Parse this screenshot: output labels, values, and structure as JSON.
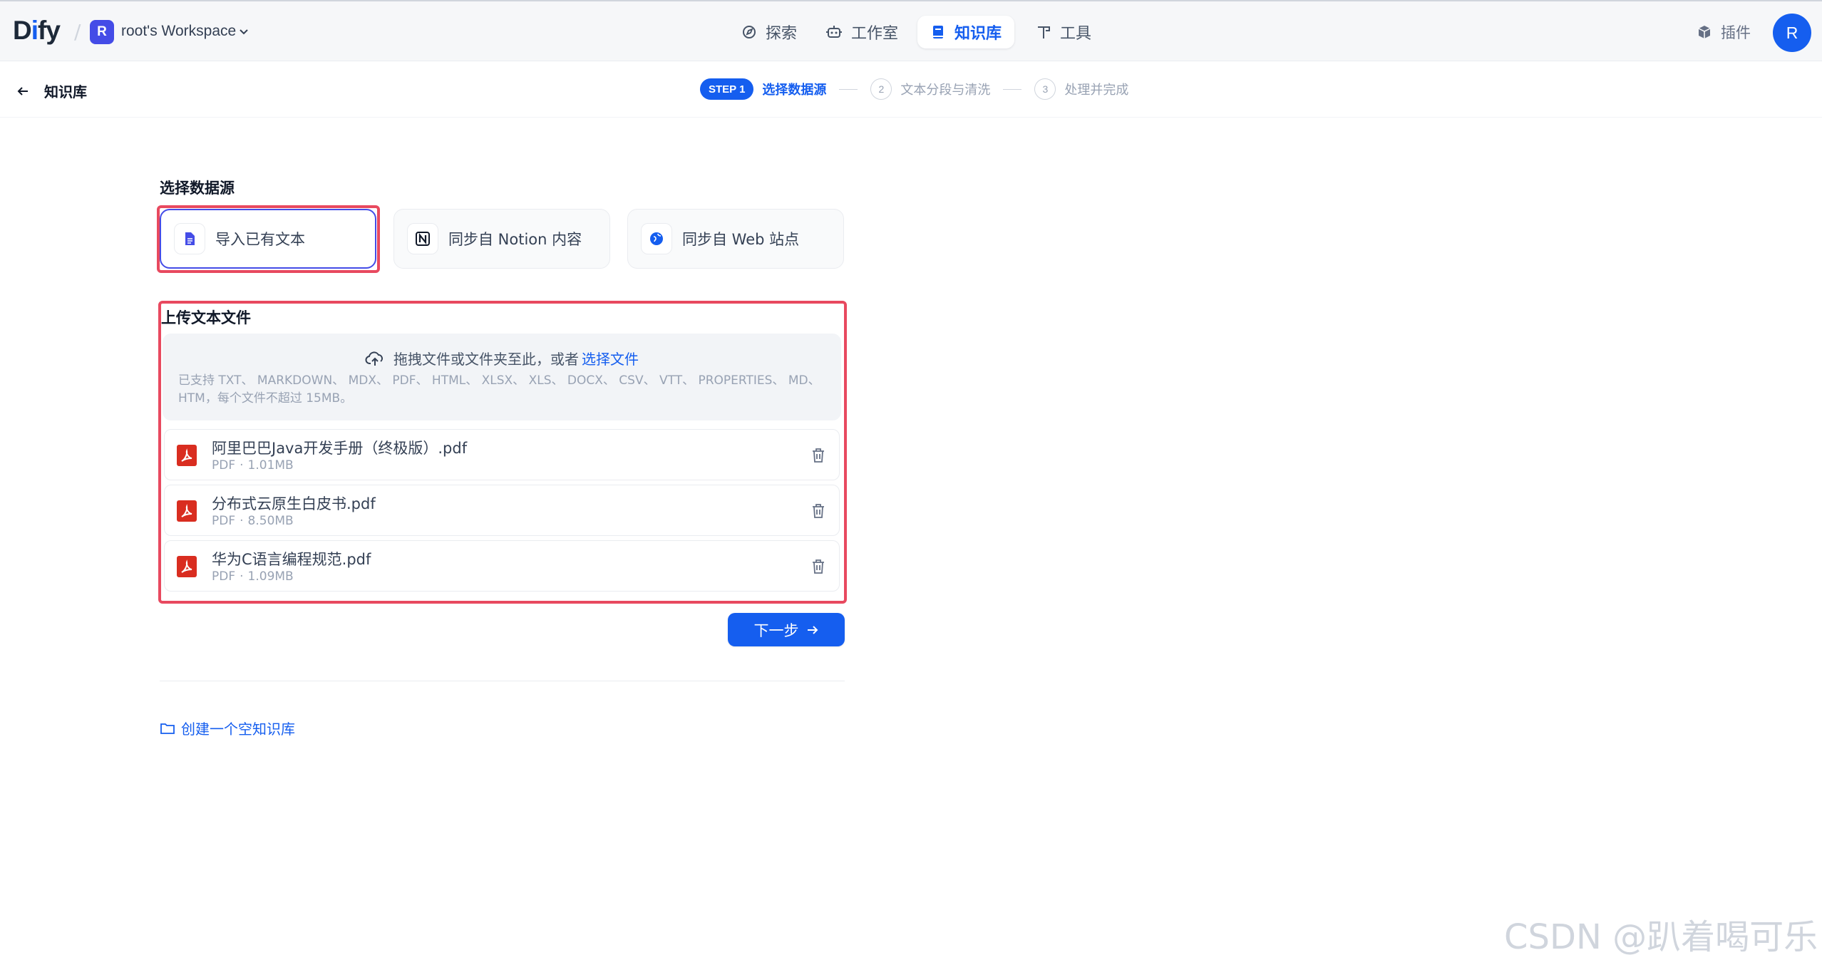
{
  "app": {
    "logo_prefix": "D",
    "logo_mid": "i",
    "logo_suffix": "fy",
    "workspace_initial": "R",
    "workspace_name": "root's Workspace"
  },
  "nav": {
    "explore": "探索",
    "studio": "工作室",
    "knowledge": "知识库",
    "tools": "工具",
    "plugins": "插件",
    "avatar": "R",
    "active": "knowledge"
  },
  "subheader": {
    "back_label": "知识库",
    "steps": [
      {
        "badge": "STEP 1",
        "label": "选择数据源",
        "active": true
      },
      {
        "num": "2",
        "label": "文本分段与清洗",
        "active": false
      },
      {
        "num": "3",
        "label": "处理并完成",
        "active": false
      }
    ]
  },
  "datasource": {
    "title": "选择数据源",
    "options": [
      {
        "label": "导入已有文本",
        "icon": "document-icon",
        "selected": true
      },
      {
        "label": "同步自 Notion 内容",
        "icon": "notion-icon",
        "selected": false
      },
      {
        "label": "同步自 Web 站点",
        "icon": "globe-icon",
        "selected": false
      }
    ]
  },
  "upload": {
    "title": "上传文本文件",
    "drop_text": "拖拽文件或文件夹至此，或者",
    "select_link": "选择文件",
    "supported": "已支持 TXT、 MARKDOWN、 MDX、 PDF、 HTML、 XLSX、 XLS、 DOCX、 CSV、 VTT、 PROPERTIES、 MD、 HTM，每个文件不超过 15MB。",
    "files": [
      {
        "name": "阿里巴巴Java开发手册（终极版）.pdf",
        "type": "PDF",
        "size": "1.01MB"
      },
      {
        "name": "分布式云原生白皮书.pdf",
        "type": "PDF",
        "size": "8.50MB"
      },
      {
        "name": "华为C语言编程规范.pdf",
        "type": "PDF",
        "size": "1.09MB"
      }
    ],
    "meta_sep": "·"
  },
  "actions": {
    "next": "下一步",
    "create_empty": "创建一个空知识库"
  },
  "watermark": "CSDN @趴着喝可乐",
  "colors": {
    "primary": "#155eef",
    "highlight": "#e8495f",
    "pdf_red": "#d92d20"
  }
}
